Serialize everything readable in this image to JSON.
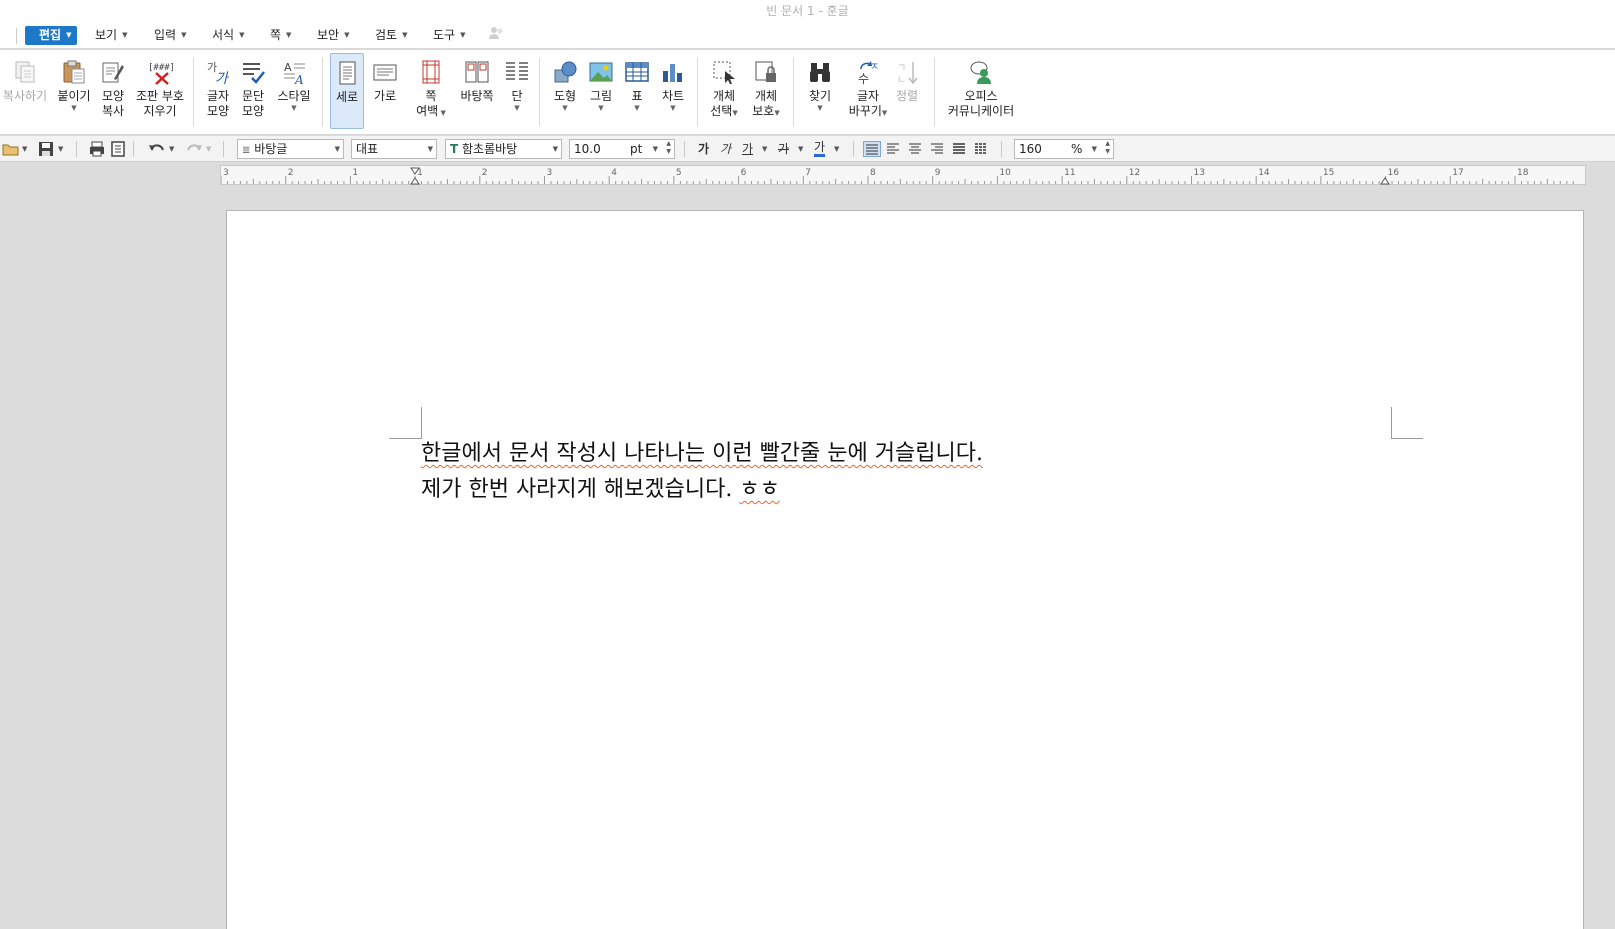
{
  "window": {
    "title": "빈 문서 1 - 훈글"
  },
  "menu": {
    "items": [
      {
        "label": "편집",
        "active": true
      },
      {
        "label": "보기"
      },
      {
        "label": "입력"
      },
      {
        "label": "서식"
      },
      {
        "label": "쪽"
      },
      {
        "label": "보안"
      },
      {
        "label": "검토"
      },
      {
        "label": "도구"
      }
    ]
  },
  "ribbon": {
    "copy": {
      "label": "복사하기",
      "icon": "copy-icon"
    },
    "paste": {
      "label": "붙이기",
      "icon": "paste-icon"
    },
    "format_copy": {
      "line1": "모양",
      "line2": "복사",
      "icon": "format-painter-icon"
    },
    "clear_marks": {
      "line1": "조판 부호",
      "line2": "지우기",
      "icon": "clear-marks-icon"
    },
    "char_shape": {
      "line1": "글자",
      "line2": "모양",
      "icon": "char-shape-icon"
    },
    "para_shape": {
      "line1": "문단",
      "line2": "모양",
      "icon": "para-shape-icon"
    },
    "style": {
      "label": "스타일",
      "icon": "style-icon"
    },
    "portrait": {
      "label": "세로",
      "icon": "portrait-page-icon"
    },
    "landscape": {
      "label": "가로",
      "icon": "landscape-page-icon"
    },
    "margins": {
      "line1": "쪽",
      "line2": "여백",
      "icon": "page-margin-icon"
    },
    "background": {
      "label": "바탕쪽",
      "icon": "background-page-icon"
    },
    "columns": {
      "label": "단",
      "icon": "columns-icon"
    },
    "shape": {
      "label": "도형",
      "icon": "shape-icon"
    },
    "picture": {
      "label": "그림",
      "icon": "picture-icon"
    },
    "table": {
      "label": "표",
      "icon": "table-icon"
    },
    "chart": {
      "label": "차트",
      "icon": "chart-icon"
    },
    "obj_select": {
      "line1": "개체",
      "line2": "선택",
      "icon": "object-select-icon"
    },
    "obj_protect": {
      "line1": "개체",
      "line2": "보호",
      "icon": "object-protect-icon"
    },
    "find": {
      "label": "찾기",
      "icon": "binoculars-icon"
    },
    "replace": {
      "line1": "글자",
      "line2": "바꾸기",
      "icon": "replace-char-icon"
    },
    "sort": {
      "label": "정렬",
      "icon": "sort-icon"
    },
    "office": {
      "line1": "오피스",
      "line2": "커뮤니케이터",
      "icon": "office-communicator-icon"
    }
  },
  "toolbar": {
    "style": "바탕글",
    "lang": "대표",
    "font": "함초롬바탕",
    "font_size": "10.0",
    "size_unit": "pt",
    "bold": "가",
    "italic": "가",
    "underline": "가",
    "strike": "가",
    "color": "가",
    "line_spacing": "160",
    "line_spacing_unit": "%"
  },
  "ruler": {
    "labels": [
      "3",
      "2",
      "1",
      "1",
      "2",
      "3",
      "4",
      "5",
      "6",
      "7",
      "8",
      "9",
      "10",
      "11",
      "12",
      "13",
      "14",
      "15",
      "16",
      "17",
      "18"
    ]
  },
  "document": {
    "line1": "한글에서 문서 작성시 나타나는 이런 빨간줄 눈에 거슬립니다.",
    "line2": "제가 한번 사라지게 해보겠습니다. ㅎㅎ",
    "line2_prefix": "제가 한번 사라지게 해보겠습니다. ",
    "line2_flagged": "ㅎㅎ"
  },
  "colors": {
    "accent": "#1e78c8",
    "spellcheck": "#e06a3a",
    "workspace": "#dcdcdc"
  }
}
